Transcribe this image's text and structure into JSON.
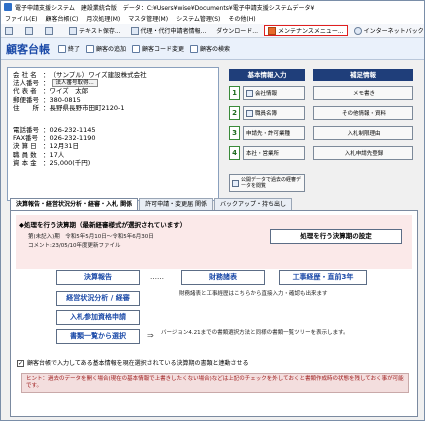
{
  "window": {
    "title": "電子申請支援システム　建設業統合版　データ：C:¥Users¥wise¥Documents¥電子申請支援システムデータ¥"
  },
  "menu": [
    "ファイル(E)",
    "顧客台帳(C)",
    "月次処理(M)",
    "マスタ管理(M)",
    "システム管理(S)",
    "その他(H)"
  ],
  "toolbar": {
    "items": [
      "テキスト保存...",
      "代理・代行申請者情報...",
      "ダウンロード...",
      "メンテナンスメニュー...",
      "インターネットバックアップ..."
    ]
  },
  "header": {
    "brand": "顧客台帳",
    "buttons": [
      "終了",
      "顧客の追加",
      "顧客コード変更",
      "顧客の検索"
    ]
  },
  "company": {
    "name_label": "会 社 名",
    "name": "（サンプル）ワイズ建設株式会社",
    "corp_label": "法人番号",
    "corp_btn": "法人番号取得...",
    "rep_label": "代 表 者",
    "rep": "ワイズ　太郎",
    "zip_label": "郵便番号",
    "zip": "380-0815",
    "addr_label": "住　　所",
    "addr": "長野県長野市田町2120-1",
    "tel_label": "電話番号",
    "tel": "026-232-1145",
    "fax_label": "FAX番号",
    "fax": "026-232-1190",
    "fy_label": "決 算 日",
    "fy": "12月31日",
    "staff_label": "職 員 数",
    "staff": "17人",
    "capital_label": "資 本 金",
    "capital": "25,000(千円)"
  },
  "basic_panel": {
    "title": "基本情報入力",
    "items": [
      {
        "num": "1",
        "label": "会社情報"
      },
      {
        "num": "2",
        "label": "職員名簿"
      },
      {
        "num": "3",
        "label": "申請先・許可業種"
      },
      {
        "num": "4",
        "label": "本社・営業所"
      }
    ]
  },
  "extra_panel": {
    "title": "補足情報",
    "items": [
      "メモ書き",
      "その他情報・資料",
      "入札制限理由",
      "入札申請先登録"
    ]
  },
  "public_data_btn": "公開データで過去の経審データを閲覧",
  "tabs": [
    "決算報告・経営状況分析・経審・入札 関係",
    "許可申請・変更届 関係",
    "バックアップ・持ち出し"
  ],
  "period": {
    "heading": "処理を行う決算期（最新経審様式が選択されています）",
    "line1": "第(未記入)期　令和5年5月10日～令和5年6月30日",
    "line2": "コメント:23/05/10年度更新ファイル",
    "set_btn": "処理を行う決算期の設定"
  },
  "actions": {
    "settlement": "決算報告",
    "dots": "……",
    "financial": "財務諸表",
    "koji": "工事経歴・直前3年",
    "koji_note": "財務諸表と工事経歴はこちらから直接入力・確認も出来ます",
    "analysis": "経営状況分析 / 経審",
    "bid": "入札参加資格申請",
    "docs": "書類一覧から選択",
    "docs_note": "バージョン4.21までの書類選択方法と同様の書類一覧ツリーを表示します。"
  },
  "link_option": {
    "checked": true,
    "label": "顧客台帳で入力してある基本情報を現在選択されている決算期の書類と連動させる"
  },
  "hint": {
    "text": "ヒント：過去のデータを開く場合(現在の基本情報で上書きしたくない場合)などは上記のチェックを外しておくと書類作成時の状態を残しておく事が可能です。"
  },
  "colors": {
    "brand": "#1b4aa8",
    "header_bg": "#1f3e7a",
    "highlight": "#e02020"
  }
}
